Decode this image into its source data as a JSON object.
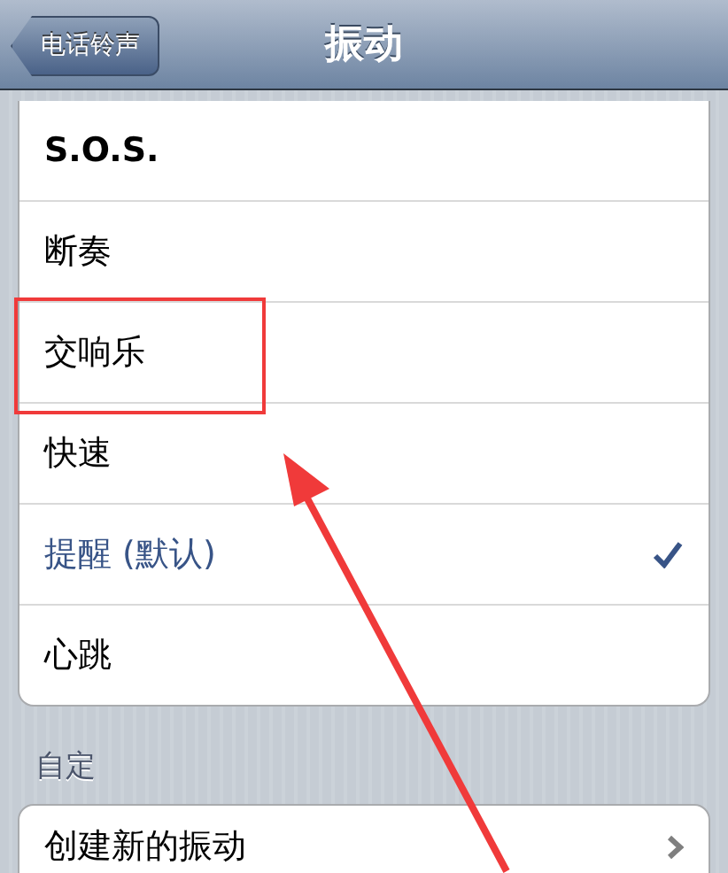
{
  "nav_bar": {
    "back_button": "电话铃声",
    "title": "振动"
  },
  "standard": [
    {
      "label": "S.O.S.",
      "selected": false,
      "highlighted": false
    },
    {
      "label": "断奏",
      "selected": false,
      "highlighted": false
    },
    {
      "label": "交响乐",
      "selected": false,
      "highlighted": true
    },
    {
      "label": "快速",
      "selected": false,
      "highlighted": false
    },
    {
      "label": "提醒 (默认)",
      "selected": true,
      "highlighted": false
    },
    {
      "label": "心跳",
      "selected": false,
      "highlighted": false
    }
  ],
  "custom": {
    "header": "自定",
    "items": [
      {
        "label": "创建新的振动"
      }
    ]
  }
}
